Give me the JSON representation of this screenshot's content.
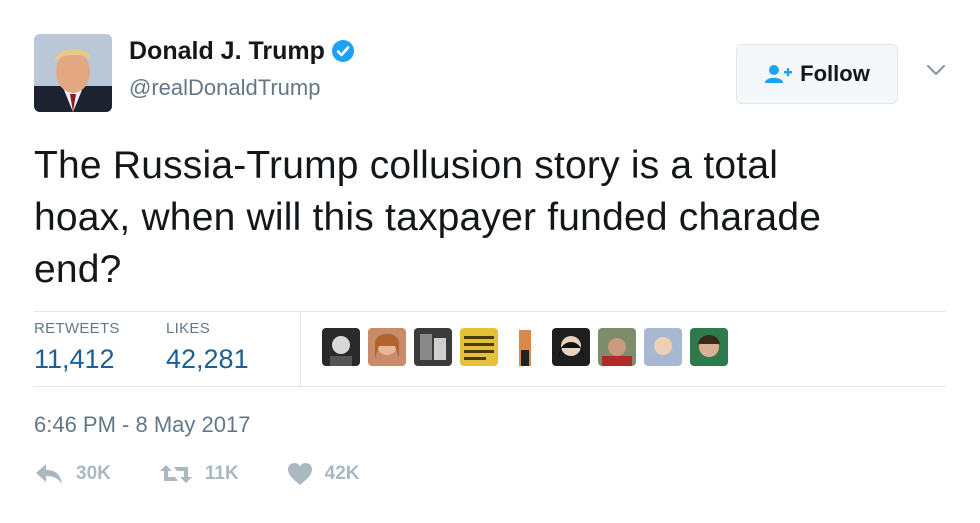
{
  "author": {
    "name": "Donald J. Trump",
    "handle": "@realDonaldTrump",
    "verified": true
  },
  "follow_button": {
    "label": "Follow"
  },
  "tweet": {
    "lines": [
      "The Russia-Trump collusion story is a total",
      "hoax, when will this taxpayer funded charade",
      "end?"
    ]
  },
  "stats": {
    "retweets_label": "RETWEETS",
    "retweets_value": "11,412",
    "likes_label": "LIKES",
    "likes_value": "42,281"
  },
  "timestamp": "6:46 PM - 8 May 2017",
  "actions": {
    "reply_count": "30K",
    "retweet_count": "11K",
    "like_count": "42K"
  },
  "colors": {
    "link_blue": "#1b5f96",
    "verified_blue": "#1da1f2",
    "muted_gray": "#657786",
    "action_gray": "#aab8c2",
    "border": "#e1e8ed"
  }
}
